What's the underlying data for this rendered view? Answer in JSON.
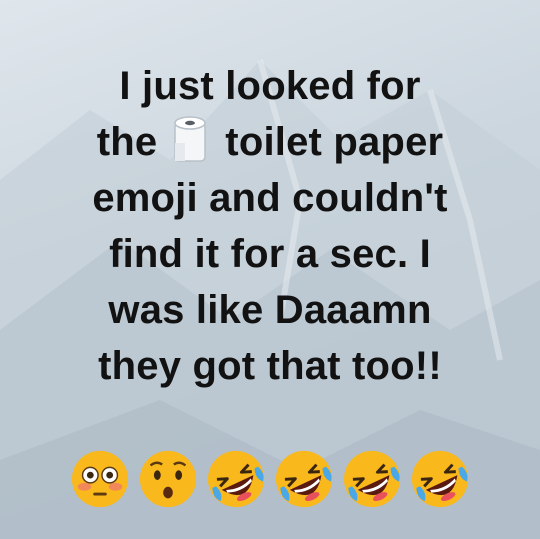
{
  "post": {
    "line1": "I just looked for",
    "line2_before": "the",
    "line2_after": "toilet paper",
    "line3": "emoji and couldn't",
    "line4": "find it for a sec. I",
    "line5": "was like Daaamn",
    "line6": "they got that too!!",
    "inline_icon": "toilet-paper-icon",
    "emojis": [
      "flushed-face-icon",
      "hushed-face-icon",
      "rolling-on-floor-laughing-icon",
      "rolling-on-floor-laughing-icon",
      "rolling-on-floor-laughing-icon",
      "rolling-on-floor-laughing-icon"
    ]
  },
  "colors": {
    "text": "#121212",
    "background": "#cdd7df",
    "emoji_yellow": "#f9b81b"
  }
}
